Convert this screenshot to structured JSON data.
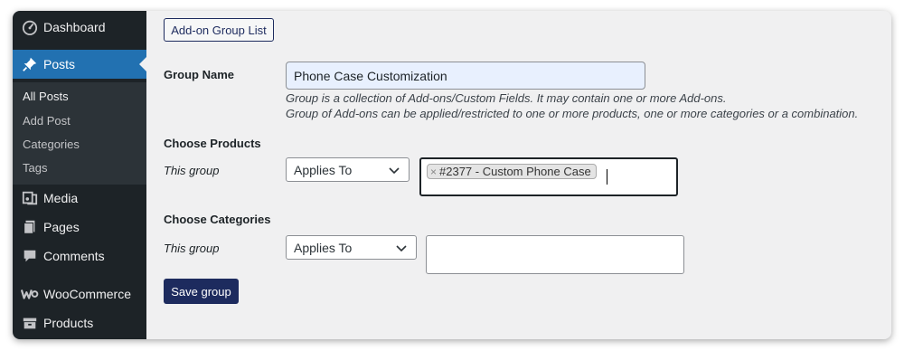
{
  "sidebar": {
    "items": [
      {
        "label": "Dashboard",
        "icon": "dashboard-icon"
      },
      {
        "label": "Posts",
        "icon": "pin-icon"
      },
      {
        "label": "Media",
        "icon": "media-icon"
      },
      {
        "label": "Pages",
        "icon": "pages-icon"
      },
      {
        "label": "Comments",
        "icon": "comments-icon"
      },
      {
        "label": "WooCommerce",
        "icon": "woocommerce-icon"
      },
      {
        "label": "Products",
        "icon": "products-icon"
      }
    ],
    "submenu": [
      "All Posts",
      "Add Post",
      "Categories",
      "Tags"
    ]
  },
  "main": {
    "addon_list_button": "Add-on Group List",
    "group_name_label": "Group Name",
    "group_name_value": "Phone Case Customization",
    "desc_line1": "Group is a collection of Add-ons/Custom Fields. It may contain one or more Add-ons.",
    "desc_line2": "Group of Add-ons can be applied/restricted to one or more products, one or more categories or a combination.",
    "products": {
      "heading": "Choose Products",
      "row_label": "This group",
      "select_value": "Applies To",
      "selected_tag": "#2377 - Custom Phone Case",
      "tag_remove": "×"
    },
    "categories": {
      "heading": "Choose Categories",
      "row_label": "This group",
      "select_value": "Applies To"
    },
    "save_button": "Save group"
  },
  "colors": {
    "sidebar_bg": "#1d2327",
    "active_bg": "#2271b1",
    "primary_button": "#1d2b5e",
    "content_bg": "#f0f0f1"
  }
}
